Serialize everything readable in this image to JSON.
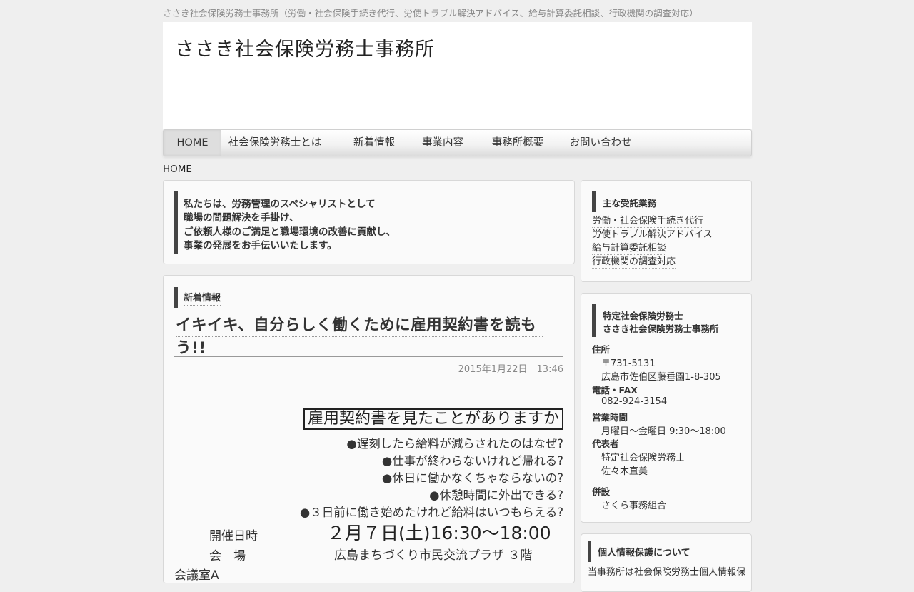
{
  "tagline": "ささき社会保険労務士事務所（労働・社会保険手続き代行、労使トラブル解決アドバイス、給与計算委託相談、行政機関の調査対応）",
  "site_title": "ささき社会保険労務士事務所",
  "nav": {
    "items": [
      {
        "label": "HOME"
      },
      {
        "label": "社会保険労務士とは"
      },
      {
        "label": "新着情報"
      },
      {
        "label": "事業内容"
      },
      {
        "label": "事務所概要"
      },
      {
        "label": "お問い合わせ"
      }
    ],
    "active": "HOME"
  },
  "breadcrumb": "HOME",
  "intro": {
    "lines": [
      "私たちは、労務管理のスペシャリストとして",
      "職場の問題解決を手掛け、",
      "ご依頼人様のご満足と職場環境の改善に貢献し、",
      "事業の発展をお手伝いいたします。"
    ]
  },
  "news": {
    "label": "新着情報",
    "title_line1": "イキイキ、自分らしく働くために雇用契約書を読もう!!",
    "title_line1_display": "イキイキ、自分らしく働くために雇用契約書を読も",
    "title_line2_display": "う!!",
    "date": "2015年1月22日　13:46",
    "flyer": {
      "headline": "雇用契約書を見たことがありますか",
      "questions": [
        "●遅刻したら給料が減らされたのはなぜ?",
        "●仕事が終わらないけれど帰れる?",
        "●休日に働かなくちゃならないの?",
        "●休憩時間に外出できる?",
        "●３日前に働き始めたけれど給料はいつもらえる?"
      ],
      "date_label": "開催日時",
      "date_value": "２月７日(土)16:30〜18:00",
      "venue_label": "会　場",
      "venue_value": "広島まちづくり市民交流プラザ ３階",
      "more_label": "会議室A"
    }
  },
  "sidebar": {
    "services": {
      "heading": "主な受託業務",
      "links": [
        "労働・社会保険手続き代行",
        "労使トラブル解決アドバイス",
        "給与計算委託相談",
        "行政機関の調査対応"
      ]
    },
    "office": {
      "heading_line1": "特定社会保険労務士",
      "heading_line2": "ささき社会保険労務士事務所",
      "address_label": "住所",
      "postal": "〒731-5131",
      "address": "広島市佐伯区藤垂園1-8-305",
      "phone_label": "電話・FAX",
      "phone": "082-924-3154",
      "hours_label": "営業時間",
      "hours": "月曜日〜金曜日 9:30〜18:00",
      "rep_label": "代表者",
      "rep_title": "特定社会保険労務士",
      "rep_name": "佐々木直美",
      "affiliate_label": "併設",
      "affiliate": "さくら事務組合"
    },
    "privacy": {
      "heading": "個人情報保護について",
      "text": "当事務所は社会保険労務士個人情報保"
    }
  }
}
